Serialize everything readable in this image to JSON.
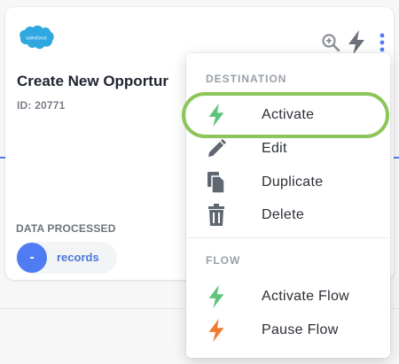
{
  "card": {
    "logo_text": "salesforce",
    "title": "Create New Opportur",
    "id_text": "ID: 20771",
    "data_processed_label": "DATA PROCESSED",
    "records_badge": "-",
    "records_label": "records"
  },
  "header_icons": [
    "zoom-icon",
    "bolt-icon",
    "kebab-menu-icon"
  ],
  "menu": {
    "destination_label": "DESTINATION",
    "destination_items": [
      {
        "label": "Activate",
        "icon": "bolt-icon",
        "icon_color": "#5dc47a"
      },
      {
        "label": "Edit",
        "icon": "pencil-icon",
        "icon_color": "#606770"
      },
      {
        "label": "Duplicate",
        "icon": "duplicate-icon",
        "icon_color": "#606770"
      },
      {
        "label": "Delete",
        "icon": "trash-icon",
        "icon_color": "#606770"
      }
    ],
    "flow_label": "FLOW",
    "flow_items": [
      {
        "label": "Activate Flow",
        "icon": "bolt-icon",
        "icon_color": "#5dc47a"
      },
      {
        "label": "Pause Flow",
        "icon": "bolt-icon",
        "icon_color": "#f07a2e"
      }
    ]
  },
  "colors": {
    "accent": "#4f7cf3",
    "highlight": "#8cc55a",
    "salesforce": "#2fa7e0"
  }
}
